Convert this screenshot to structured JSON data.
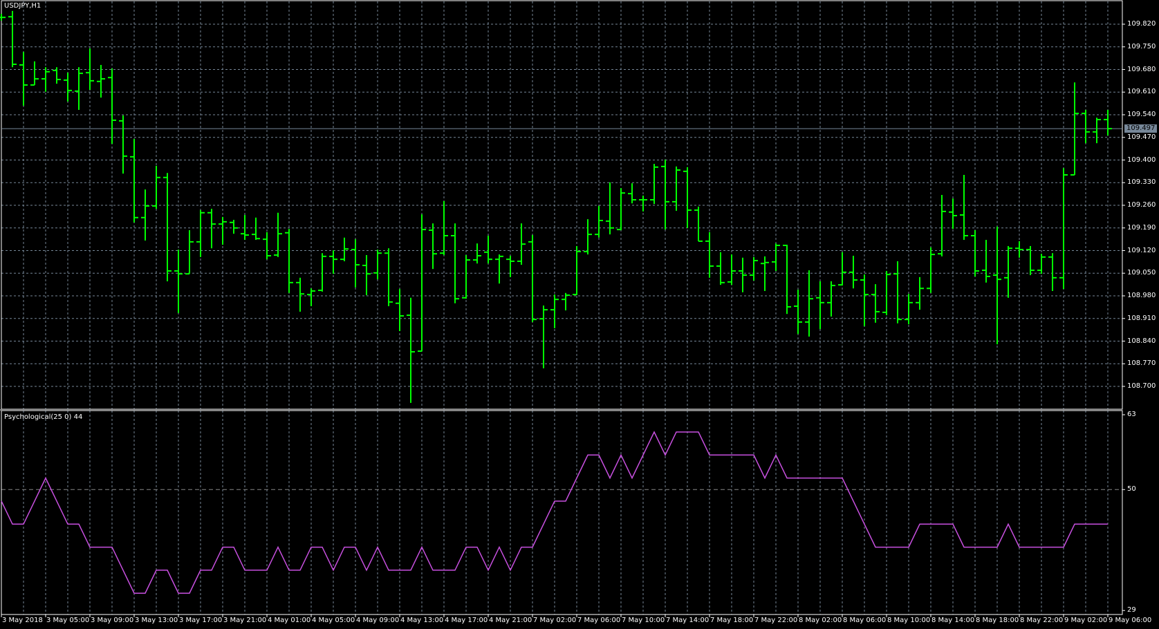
{
  "window": {
    "symbol_label": "USDJPY,H1"
  },
  "indicator": {
    "label": "Psychological(25 0) 44"
  },
  "current_price": "109.497",
  "colors": {
    "background": "#000000",
    "grid": "#778899",
    "bars": "#00ff00",
    "indicator_line": "#c850e0",
    "axis": "#ffffff",
    "price_line": "#778899"
  },
  "chart_data": [
    {
      "type": "bar",
      "subtype": "ohlc",
      "title": "USDJPY,H1",
      "ylim": [
        108.631,
        109.895
      ],
      "y_ticks": [
        "109.820",
        "109.750",
        "109.680",
        "109.610",
        "109.540",
        "109.470",
        "109.400",
        "109.330",
        "109.260",
        "109.190",
        "109.120",
        "109.050",
        "108.980",
        "108.910",
        "108.840",
        "108.770",
        "108.700"
      ],
      "x_ticks": [
        "3 May 2018",
        "3 May 05:00",
        "3 May 09:00",
        "3 May 13:00",
        "3 May 17:00",
        "3 May 21:00",
        "4 May 01:00",
        "4 May 05:00",
        "4 May 09:00",
        "4 May 13:00",
        "4 May 17:00",
        "4 May 21:00",
        "7 May 02:00",
        "7 May 06:00",
        "7 May 10:00",
        "7 May 14:00",
        "7 May 18:00",
        "7 May 22:00",
        "8 May 02:00",
        "8 May 06:00",
        "8 May 10:00",
        "8 May 14:00",
        "8 May 18:00",
        "8 May 22:00",
        "9 May 02:00",
        "9 May 06:00"
      ],
      "x_tick_every_bars": 4,
      "grid": true,
      "current_price": 109.497,
      "ohlc": [
        [
          109.841,
          109.852,
          109.831,
          109.841
        ],
        [
          109.843,
          109.861,
          109.687,
          109.696
        ],
        [
          109.694,
          109.734,
          109.568,
          109.632
        ],
        [
          109.632,
          109.705,
          109.632,
          109.651
        ],
        [
          109.651,
          109.687,
          109.611,
          109.673
        ],
        [
          109.677,
          109.687,
          109.636,
          109.649
        ],
        [
          109.647,
          109.67,
          109.581,
          109.615
        ],
        [
          109.613,
          109.687,
          109.555,
          109.668
        ],
        [
          109.67,
          109.745,
          109.617,
          109.645
        ],
        [
          109.643,
          109.694,
          109.593,
          109.651
        ],
        [
          109.655,
          109.683,
          109.45,
          109.523
        ],
        [
          109.521,
          109.538,
          109.358,
          109.412
        ],
        [
          109.41,
          109.465,
          109.207,
          109.222
        ],
        [
          109.222,
          109.309,
          109.151,
          109.258
        ],
        [
          109.258,
          109.382,
          109.249,
          109.346
        ],
        [
          109.346,
          109.36,
          109.025,
          109.057
        ],
        [
          109.057,
          109.123,
          108.927,
          109.048
        ],
        [
          109.048,
          109.183,
          109.048,
          109.147
        ],
        [
          109.147,
          109.245,
          109.1,
          109.237
        ],
        [
          109.237,
          109.249,
          109.127,
          109.202
        ],
        [
          109.202,
          109.224,
          109.138,
          109.209
        ],
        [
          109.207,
          109.215,
          109.172,
          109.19
        ],
        [
          109.172,
          109.23,
          109.153,
          109.168
        ],
        [
          109.17,
          109.222,
          109.153,
          109.157
        ],
        [
          109.155,
          109.177,
          109.093,
          109.104
        ],
        [
          109.106,
          109.237,
          109.1,
          109.172
        ],
        [
          109.175,
          109.187,
          108.989,
          109.021
        ],
        [
          109.021,
          109.036,
          108.931,
          108.986
        ],
        [
          108.984,
          109.003,
          108.948,
          108.995
        ],
        [
          108.997,
          109.112,
          108.993,
          109.102
        ],
        [
          109.102,
          109.121,
          109.048,
          109.093
        ],
        [
          109.093,
          109.16,
          109.087,
          109.125
        ],
        [
          109.123,
          109.155,
          109.006,
          109.076
        ],
        [
          109.074,
          109.106,
          108.982,
          109.048
        ],
        [
          109.051,
          109.123,
          109.031,
          109.112
        ],
        [
          109.112,
          109.127,
          108.948,
          108.961
        ],
        [
          108.957,
          109.001,
          108.871,
          108.918
        ],
        [
          108.92,
          108.974,
          108.649,
          108.807
        ],
        [
          108.809,
          109.232,
          108.809,
          109.185
        ],
        [
          109.183,
          109.204,
          109.063,
          109.11
        ],
        [
          109.112,
          109.273,
          109.106,
          109.166
        ],
        [
          109.166,
          109.204,
          108.957,
          108.971
        ],
        [
          108.974,
          109.106,
          108.971,
          109.091
        ],
        [
          109.091,
          109.142,
          109.08,
          109.104
        ],
        [
          109.115,
          109.166,
          109.08,
          109.093
        ],
        [
          109.093,
          109.108,
          109.018,
          109.102
        ],
        [
          109.093,
          109.104,
          109.038,
          109.087
        ],
        [
          109.087,
          109.204,
          109.076,
          109.14
        ],
        [
          109.147,
          109.168,
          108.899,
          108.907
        ],
        [
          108.909,
          108.95,
          108.756,
          108.937
        ],
        [
          108.937,
          108.984,
          108.88,
          108.969
        ],
        [
          108.969,
          108.989,
          108.935,
          108.982
        ],
        [
          108.984,
          109.134,
          108.982,
          109.117
        ],
        [
          109.117,
          109.217,
          109.108,
          109.17
        ],
        [
          109.17,
          109.258,
          109.16,
          109.213
        ],
        [
          109.211,
          109.331,
          109.17,
          109.19
        ],
        [
          109.185,
          109.313,
          109.183,
          109.298
        ],
        [
          109.296,
          109.328,
          109.266,
          109.277
        ],
        [
          109.277,
          109.29,
          109.241,
          109.277
        ],
        [
          109.277,
          109.388,
          109.264,
          109.378
        ],
        [
          109.38,
          109.401,
          109.185,
          109.271
        ],
        [
          109.271,
          109.38,
          109.243,
          109.369
        ],
        [
          109.365,
          109.378,
          109.19,
          109.245
        ],
        [
          109.245,
          109.256,
          109.149,
          109.149
        ],
        [
          109.149,
          109.177,
          109.036,
          109.072
        ],
        [
          109.072,
          109.115,
          109.014,
          109.021
        ],
        [
          109.023,
          109.108,
          109.014,
          109.057
        ],
        [
          109.057,
          109.098,
          108.991,
          109.044
        ],
        [
          109.044,
          109.1,
          109.027,
          109.089
        ],
        [
          109.08,
          109.102,
          108.995,
          109.083
        ],
        [
          109.085,
          109.142,
          109.057,
          109.136
        ],
        [
          109.136,
          109.138,
          108.924,
          108.946
        ],
        [
          108.948,
          108.999,
          108.862,
          108.899
        ],
        [
          108.899,
          109.059,
          108.854,
          108.971
        ],
        [
          108.974,
          109.025,
          108.877,
          108.959
        ],
        [
          108.959,
          109.025,
          108.916,
          109.012
        ],
        [
          109.014,
          109.115,
          109.012,
          109.053
        ],
        [
          109.053,
          109.104,
          109.003,
          109.029
        ],
        [
          109.029,
          109.046,
          108.886,
          108.984
        ],
        [
          108.984,
          109.016,
          108.897,
          108.931
        ],
        [
          108.929,
          109.057,
          108.92,
          109.046
        ],
        [
          109.048,
          109.087,
          108.895,
          108.907
        ],
        [
          108.907,
          108.986,
          108.892,
          108.959
        ],
        [
          108.959,
          109.038,
          108.937,
          109.003
        ],
        [
          109.003,
          109.13,
          108.989,
          109.108
        ],
        [
          109.11,
          109.292,
          109.102,
          109.241
        ],
        [
          109.239,
          109.281,
          109.187,
          109.228
        ],
        [
          109.23,
          109.354,
          109.153,
          109.166
        ],
        [
          109.166,
          109.183,
          109.04,
          109.057
        ],
        [
          109.059,
          109.153,
          109.021,
          109.04
        ],
        [
          109.044,
          109.194,
          108.83,
          109.031
        ],
        [
          109.036,
          109.134,
          108.974,
          109.127
        ],
        [
          109.127,
          109.149,
          109.098,
          109.123
        ],
        [
          109.123,
          109.134,
          109.044,
          109.059
        ],
        [
          109.059,
          109.11,
          109.048,
          109.1
        ],
        [
          109.1,
          109.112,
          108.995,
          109.036
        ],
        [
          109.036,
          109.375,
          109.001,
          109.354
        ],
        [
          109.354,
          109.64,
          109.354,
          109.544
        ],
        [
          109.544,
          109.555,
          109.452,
          109.487
        ],
        [
          109.487,
          109.531,
          109.452,
          109.525
        ],
        [
          109.525,
          109.555,
          109.476,
          109.497
        ]
      ]
    },
    {
      "type": "line",
      "title": "Psychological(25 0) 44",
      "ylim": [
        29,
        63
      ],
      "y_ticks": [
        "63",
        "50",
        "29"
      ],
      "level": 50,
      "values": [
        48,
        44,
        44,
        48,
        52,
        48,
        44,
        44,
        40,
        40,
        40,
        36,
        32,
        32,
        36,
        36,
        32,
        32,
        36,
        36,
        40,
        40,
        36,
        36,
        36,
        40,
        36,
        36,
        40,
        40,
        36,
        40,
        40,
        36,
        40,
        36,
        36,
        36,
        40,
        36,
        36,
        36,
        40,
        40,
        36,
        40,
        36,
        40,
        40,
        44,
        48,
        48,
        52,
        56,
        56,
        52,
        56,
        52,
        56,
        60,
        56,
        60,
        60,
        60,
        56,
        56,
        56,
        56,
        56,
        52,
        56,
        52,
        52,
        52,
        52,
        52,
        52,
        48,
        44,
        40,
        40,
        40,
        40,
        44,
        44,
        44,
        44,
        40,
        40,
        40,
        40,
        44,
        40,
        40,
        40,
        40,
        40,
        44,
        44,
        44,
        44
      ]
    }
  ]
}
